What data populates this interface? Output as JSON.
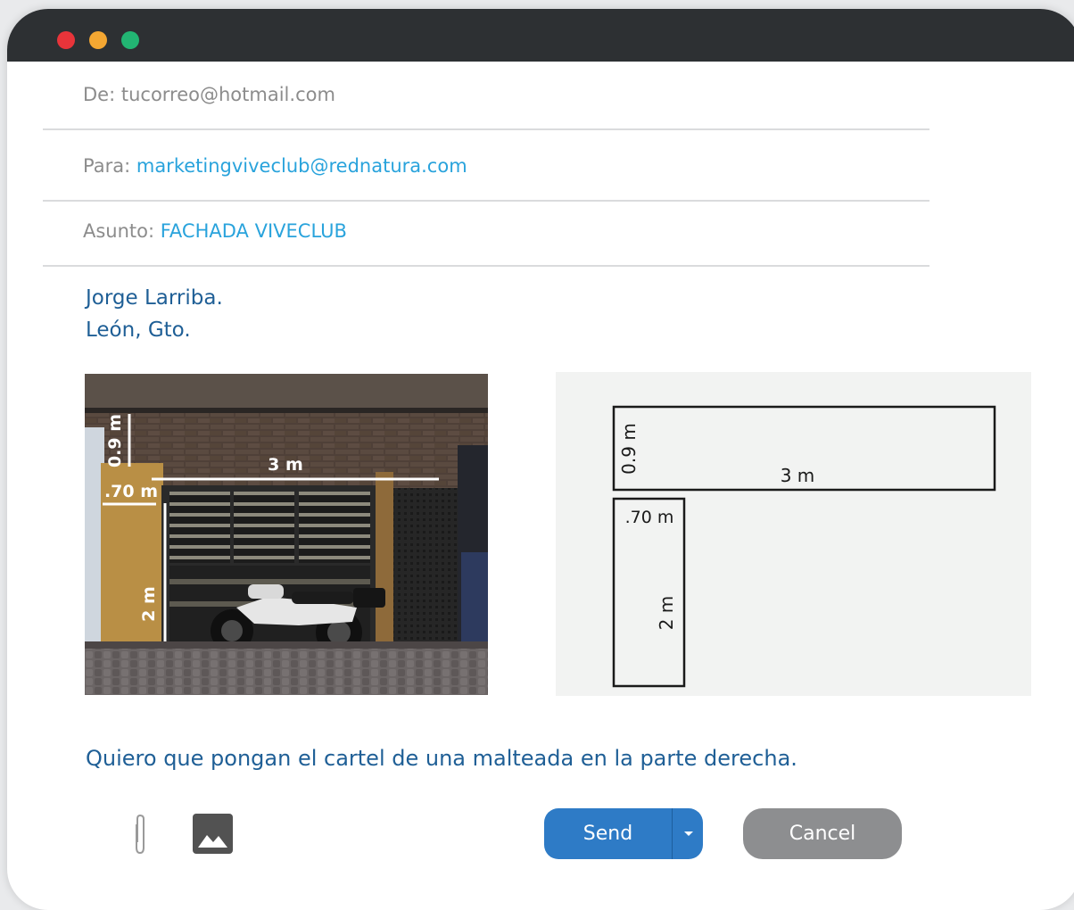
{
  "header": {
    "from_label": "De:",
    "from_value": "tucorreo@hotmail.com",
    "to_label": "Para:",
    "to_value": "marketingviveclub@rednatura.com",
    "subject_label": "Asunto:",
    "subject_value": "FACHADA VIVECLUB"
  },
  "signature": {
    "name": "Jorge Larriba.",
    "city": "León, Gto."
  },
  "photo_labels": {
    "height_top": "0.9 m",
    "width_top": "3 m",
    "width_side": ".70 m",
    "height_side": "2 m"
  },
  "sketch_labels": {
    "height_top": "0.9 m",
    "width_top": "3 m",
    "width_side": ".70 m",
    "height_side": "2 m"
  },
  "message": "Quiero que pongan el cartel de una malteada en la parte derecha.",
  "toolbar": {
    "send_label": "Send",
    "cancel_label": "Cancel",
    "attach_icon": "paperclip-icon",
    "image_icon": "image-icon"
  },
  "colors": {
    "titlebar": "#2d3033",
    "accent_blue": "#29a3dc",
    "text_blue": "#1f5f96",
    "send_button": "#2e7bc6",
    "cancel_button": "#8d8e90"
  }
}
